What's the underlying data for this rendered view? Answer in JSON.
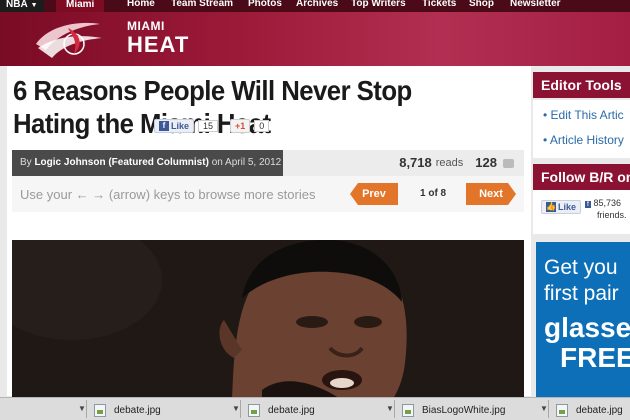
{
  "nav": {
    "league": "NBA",
    "team": "Miami",
    "items": [
      "Home",
      "Team Stream",
      "Photos",
      "Archives",
      "Top Writers",
      "Tickets",
      "Shop",
      "Newsletter"
    ]
  },
  "header": {
    "city": "MIAMI",
    "mascot": "HEAT"
  },
  "article": {
    "title": "6 Reasons People Will Never Stop Hating the Miami Heat",
    "fb_like_label": "Like",
    "fb_like_count": "15",
    "gplus_label": "+1",
    "gplus_count": "0",
    "byline_by": "By",
    "author": "Logic Johnson (Featured Columnist)",
    "byline_on": "on",
    "date": "April 5, 2012",
    "reads_count": "8,718",
    "reads_label": "reads",
    "comments_count": "128",
    "browse_hint": "Use your ← → (arrow) keys to browse more stories",
    "prev_label": "Prev",
    "next_label": "Next",
    "page_indicator": "1 of 8"
  },
  "sidebar": {
    "editor_tools_title": "Editor Tools",
    "editor_links": [
      "Edit This Artic",
      "Article History"
    ],
    "follow_title": "Follow B/R on I",
    "like_label": "Like",
    "fans_count": "85,736",
    "fans_suffix": "friends.",
    "ad_lines": [
      "Get you",
      "first pair",
      "glasse",
      "FREE"
    ]
  },
  "downloads": [
    "debate.jpg",
    "debate.jpg",
    "BiasLogoWhite.jpg",
    "debate.jpg"
  ],
  "colors": {
    "nav_bg": "#4a0a18",
    "header_red": "#9e1b3a",
    "accent_orange": "#e2752a",
    "sidebar_head": "#8c1233",
    "link_blue": "#2a6aa8",
    "ad_blue": "#0d6fb8"
  }
}
